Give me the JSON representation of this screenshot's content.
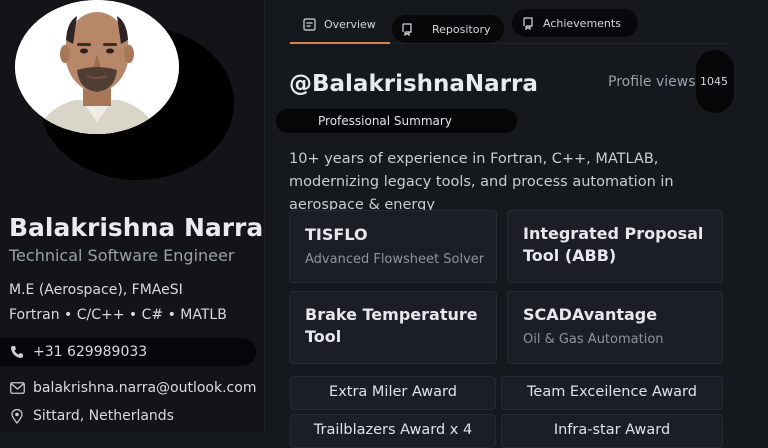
{
  "profile": {
    "name": "Balakrishna Narra",
    "role": "Technical Software Engineer",
    "degree": "M.E (Aerospace), FMAeSI",
    "skills": "Fortran • C/C++ • C# • MATLB",
    "phone": "+31 629989033",
    "email": "balakrishna.narra@outlook.com",
    "location": "Sittard, Netherlands"
  },
  "tabs": [
    {
      "label": "Overview",
      "icon": "document-icon",
      "active": true
    },
    {
      "label": "Repository",
      "icon": "repo-icon",
      "active": false
    },
    {
      "label": "Achievements",
      "icon": "trophy-icon",
      "active": false
    }
  ],
  "main": {
    "handle": "@BalakrishnaNarra",
    "profile_views_label": "Profile  views",
    "profile_views_count": "1045",
    "section_title": "Professional Summary",
    "summary": "10+ years of experience in Fortran, C++, MATLAB, modernizing legacy tools, and process automation in aerospace & energy"
  },
  "projects": [
    {
      "title": "TISFLO",
      "subtitle": "Advanced Flowsheet Solver"
    },
    {
      "title": "Integrated Proposal Tool (ABB)",
      "subtitle": ""
    },
    {
      "title": "Brake Temperature Tool",
      "subtitle": ""
    },
    {
      "title": "SCADAvantage",
      "subtitle": "Oil & Gas Automation"
    }
  ],
  "awards": [
    "Extra Miler Award",
    "Team Exceilence Award",
    "Trailblazers Award x 4",
    "Infra-star Award"
  ],
  "colors": {
    "background": "#15181d",
    "sidebar": "#121418",
    "card": "#1b1f25",
    "accent": "#d9824a"
  }
}
